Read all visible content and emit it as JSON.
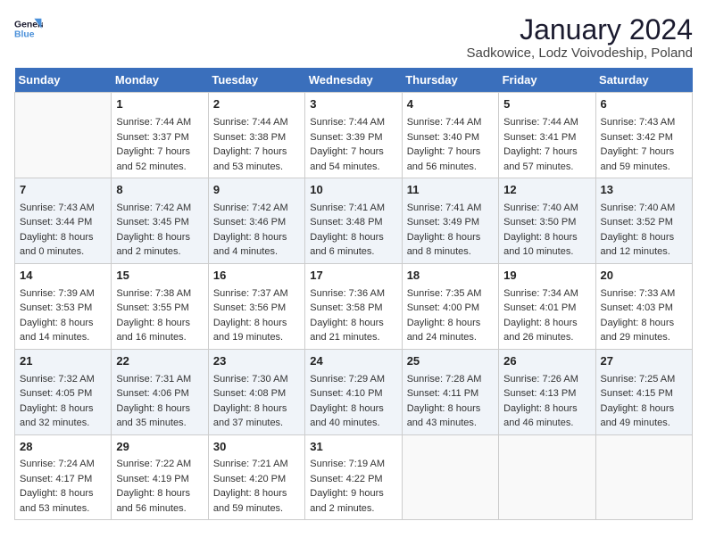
{
  "logo": {
    "line1": "General",
    "line2": "Blue"
  },
  "title": "January 2024",
  "subtitle": "Sadkowice, Lodz Voivodeship, Poland",
  "days_of_week": [
    "Sunday",
    "Monday",
    "Tuesday",
    "Wednesday",
    "Thursday",
    "Friday",
    "Saturday"
  ],
  "weeks": [
    [
      {
        "day": "",
        "sunrise": "",
        "sunset": "",
        "daylight": ""
      },
      {
        "day": "1",
        "sunrise": "Sunrise: 7:44 AM",
        "sunset": "Sunset: 3:37 PM",
        "daylight": "Daylight: 7 hours and 52 minutes."
      },
      {
        "day": "2",
        "sunrise": "Sunrise: 7:44 AM",
        "sunset": "Sunset: 3:38 PM",
        "daylight": "Daylight: 7 hours and 53 minutes."
      },
      {
        "day": "3",
        "sunrise": "Sunrise: 7:44 AM",
        "sunset": "Sunset: 3:39 PM",
        "daylight": "Daylight: 7 hours and 54 minutes."
      },
      {
        "day": "4",
        "sunrise": "Sunrise: 7:44 AM",
        "sunset": "Sunset: 3:40 PM",
        "daylight": "Daylight: 7 hours and 56 minutes."
      },
      {
        "day": "5",
        "sunrise": "Sunrise: 7:44 AM",
        "sunset": "Sunset: 3:41 PM",
        "daylight": "Daylight: 7 hours and 57 minutes."
      },
      {
        "day": "6",
        "sunrise": "Sunrise: 7:43 AM",
        "sunset": "Sunset: 3:42 PM",
        "daylight": "Daylight: 7 hours and 59 minutes."
      }
    ],
    [
      {
        "day": "7",
        "sunrise": "Sunrise: 7:43 AM",
        "sunset": "Sunset: 3:44 PM",
        "daylight": "Daylight: 8 hours and 0 minutes."
      },
      {
        "day": "8",
        "sunrise": "Sunrise: 7:42 AM",
        "sunset": "Sunset: 3:45 PM",
        "daylight": "Daylight: 8 hours and 2 minutes."
      },
      {
        "day": "9",
        "sunrise": "Sunrise: 7:42 AM",
        "sunset": "Sunset: 3:46 PM",
        "daylight": "Daylight: 8 hours and 4 minutes."
      },
      {
        "day": "10",
        "sunrise": "Sunrise: 7:41 AM",
        "sunset": "Sunset: 3:48 PM",
        "daylight": "Daylight: 8 hours and 6 minutes."
      },
      {
        "day": "11",
        "sunrise": "Sunrise: 7:41 AM",
        "sunset": "Sunset: 3:49 PM",
        "daylight": "Daylight: 8 hours and 8 minutes."
      },
      {
        "day": "12",
        "sunrise": "Sunrise: 7:40 AM",
        "sunset": "Sunset: 3:50 PM",
        "daylight": "Daylight: 8 hours and 10 minutes."
      },
      {
        "day": "13",
        "sunrise": "Sunrise: 7:40 AM",
        "sunset": "Sunset: 3:52 PM",
        "daylight": "Daylight: 8 hours and 12 minutes."
      }
    ],
    [
      {
        "day": "14",
        "sunrise": "Sunrise: 7:39 AM",
        "sunset": "Sunset: 3:53 PM",
        "daylight": "Daylight: 8 hours and 14 minutes."
      },
      {
        "day": "15",
        "sunrise": "Sunrise: 7:38 AM",
        "sunset": "Sunset: 3:55 PM",
        "daylight": "Daylight: 8 hours and 16 minutes."
      },
      {
        "day": "16",
        "sunrise": "Sunrise: 7:37 AM",
        "sunset": "Sunset: 3:56 PM",
        "daylight": "Daylight: 8 hours and 19 minutes."
      },
      {
        "day": "17",
        "sunrise": "Sunrise: 7:36 AM",
        "sunset": "Sunset: 3:58 PM",
        "daylight": "Daylight: 8 hours and 21 minutes."
      },
      {
        "day": "18",
        "sunrise": "Sunrise: 7:35 AM",
        "sunset": "Sunset: 4:00 PM",
        "daylight": "Daylight: 8 hours and 24 minutes."
      },
      {
        "day": "19",
        "sunrise": "Sunrise: 7:34 AM",
        "sunset": "Sunset: 4:01 PM",
        "daylight": "Daylight: 8 hours and 26 minutes."
      },
      {
        "day": "20",
        "sunrise": "Sunrise: 7:33 AM",
        "sunset": "Sunset: 4:03 PM",
        "daylight": "Daylight: 8 hours and 29 minutes."
      }
    ],
    [
      {
        "day": "21",
        "sunrise": "Sunrise: 7:32 AM",
        "sunset": "Sunset: 4:05 PM",
        "daylight": "Daylight: 8 hours and 32 minutes."
      },
      {
        "day": "22",
        "sunrise": "Sunrise: 7:31 AM",
        "sunset": "Sunset: 4:06 PM",
        "daylight": "Daylight: 8 hours and 35 minutes."
      },
      {
        "day": "23",
        "sunrise": "Sunrise: 7:30 AM",
        "sunset": "Sunset: 4:08 PM",
        "daylight": "Daylight: 8 hours and 37 minutes."
      },
      {
        "day": "24",
        "sunrise": "Sunrise: 7:29 AM",
        "sunset": "Sunset: 4:10 PM",
        "daylight": "Daylight: 8 hours and 40 minutes."
      },
      {
        "day": "25",
        "sunrise": "Sunrise: 7:28 AM",
        "sunset": "Sunset: 4:11 PM",
        "daylight": "Daylight: 8 hours and 43 minutes."
      },
      {
        "day": "26",
        "sunrise": "Sunrise: 7:26 AM",
        "sunset": "Sunset: 4:13 PM",
        "daylight": "Daylight: 8 hours and 46 minutes."
      },
      {
        "day": "27",
        "sunrise": "Sunrise: 7:25 AM",
        "sunset": "Sunset: 4:15 PM",
        "daylight": "Daylight: 8 hours and 49 minutes."
      }
    ],
    [
      {
        "day": "28",
        "sunrise": "Sunrise: 7:24 AM",
        "sunset": "Sunset: 4:17 PM",
        "daylight": "Daylight: 8 hours and 53 minutes."
      },
      {
        "day": "29",
        "sunrise": "Sunrise: 7:22 AM",
        "sunset": "Sunset: 4:19 PM",
        "daylight": "Daylight: 8 hours and 56 minutes."
      },
      {
        "day": "30",
        "sunrise": "Sunrise: 7:21 AM",
        "sunset": "Sunset: 4:20 PM",
        "daylight": "Daylight: 8 hours and 59 minutes."
      },
      {
        "day": "31",
        "sunrise": "Sunrise: 7:19 AM",
        "sunset": "Sunset: 4:22 PM",
        "daylight": "Daylight: 9 hours and 2 minutes."
      },
      {
        "day": "",
        "sunrise": "",
        "sunset": "",
        "daylight": ""
      },
      {
        "day": "",
        "sunrise": "",
        "sunset": "",
        "daylight": ""
      },
      {
        "day": "",
        "sunrise": "",
        "sunset": "",
        "daylight": ""
      }
    ]
  ]
}
